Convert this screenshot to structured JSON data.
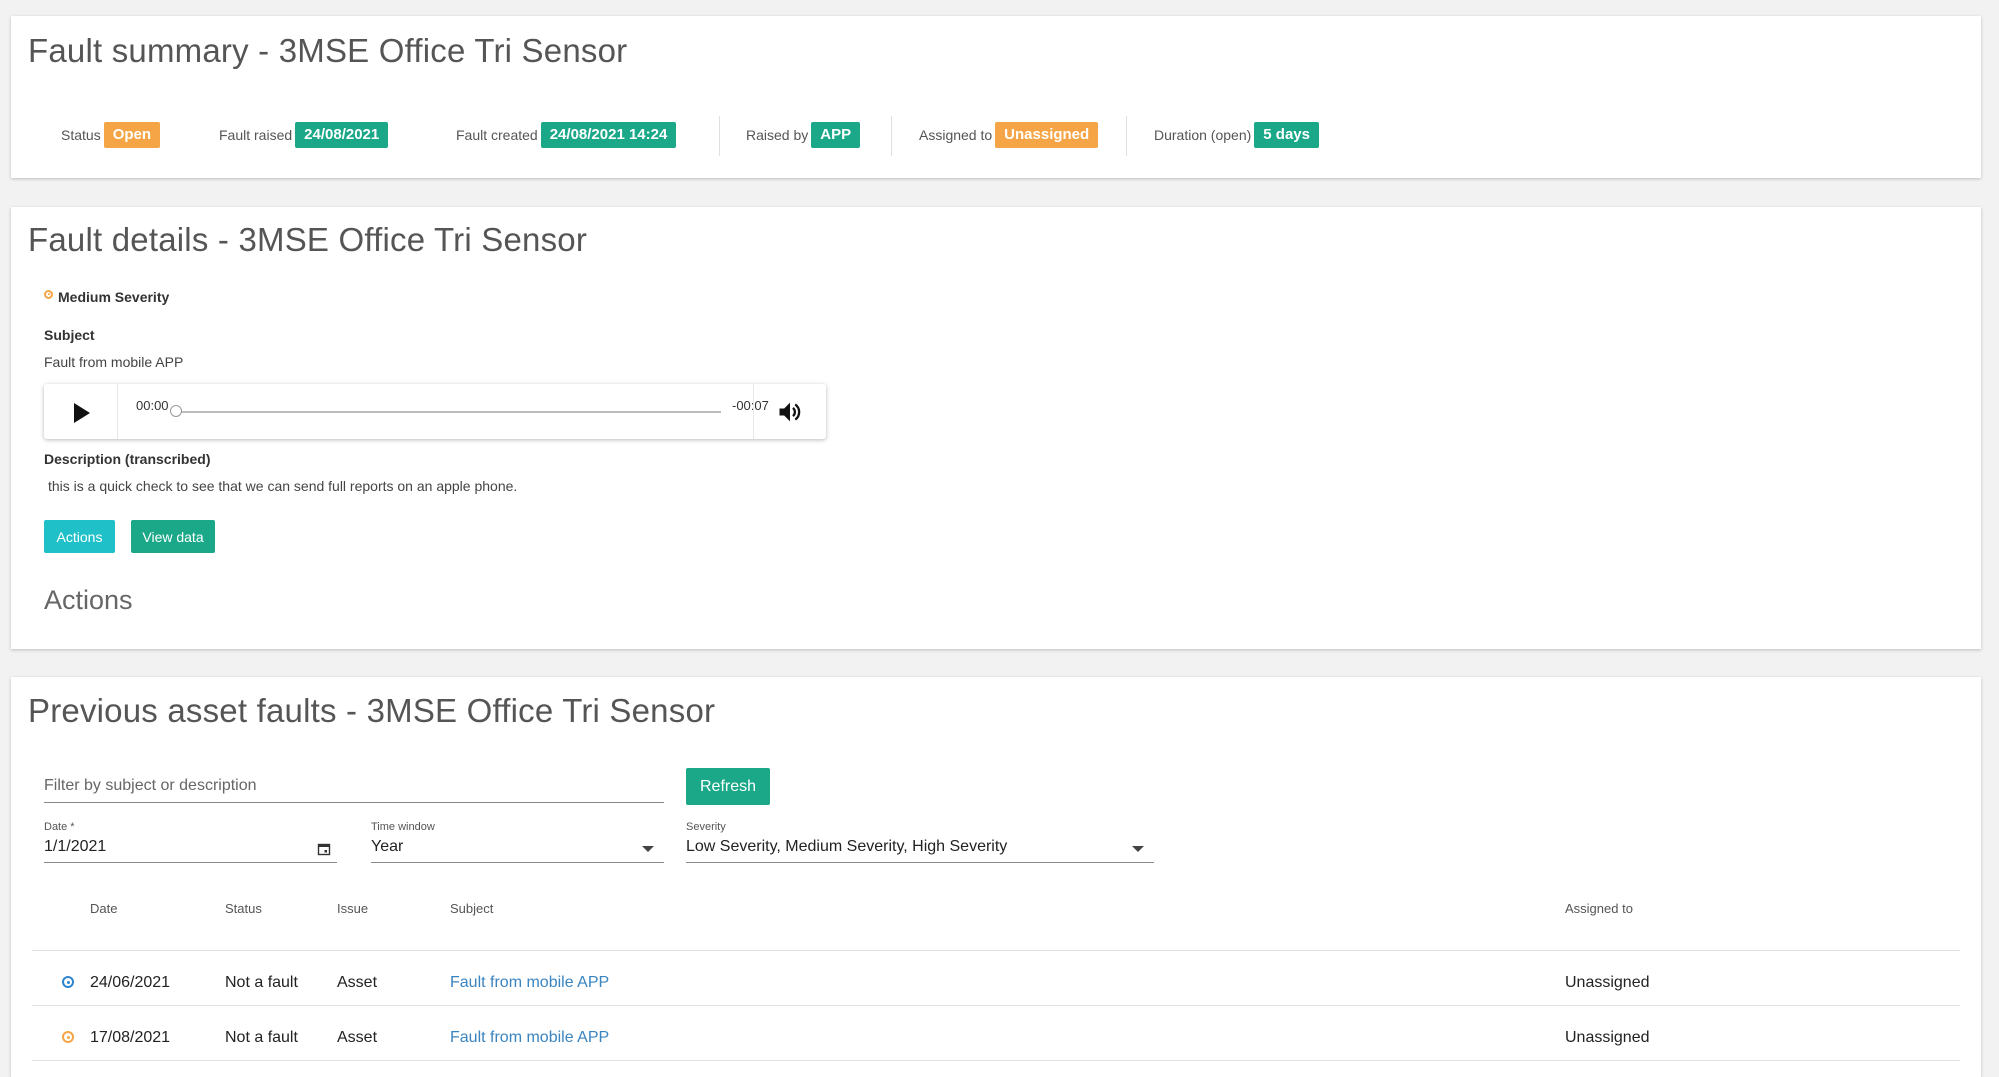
{
  "summary": {
    "title": "Fault summary - 3MSE Office Tri Sensor",
    "status": {
      "label": "Status",
      "value": "Open"
    },
    "fault_raised": {
      "label": "Fault raised",
      "value": "24/08/2021"
    },
    "fault_created": {
      "label": "Fault created",
      "value": "24/08/2021 14:24"
    },
    "raised_by": {
      "label": "Raised by",
      "value": "APP"
    },
    "assigned_to": {
      "label": "Assigned to",
      "value": "Unassigned"
    },
    "duration": {
      "label": "Duration (open)",
      "value": "5 days"
    }
  },
  "details": {
    "title": "Fault details - 3MSE Office Tri Sensor",
    "severity": "Medium Severity",
    "subject_label": "Subject",
    "subject_value": "Fault from mobile APP",
    "audio": {
      "current_time": "00:00",
      "remaining_time": "-00:07"
    },
    "description_label": "Description (transcribed)",
    "description_value": "this is a quick check to see that we can send full reports on an apple phone.",
    "actions_button": "Actions",
    "view_data_button": "View data",
    "actions_heading": "Actions"
  },
  "previous": {
    "title": "Previous asset faults - 3MSE Office Tri Sensor",
    "filter_placeholder": "Filter by subject or description",
    "refresh_button": "Refresh",
    "date_label": "Date *",
    "date_value": "1/1/2021",
    "time_window_label": "Time window",
    "time_window_value": "Year",
    "severity_label": "Severity",
    "severity_value": "Low Severity, Medium Severity, High Severity",
    "columns": {
      "date": "Date",
      "status": "Status",
      "issue": "Issue",
      "subject": "Subject",
      "assigned_to": "Assigned to"
    },
    "rows": [
      {
        "date": "24/06/2021",
        "status": "Not a fault",
        "issue": "Asset",
        "subject": "Fault from mobile APP",
        "assigned_to": "Unassigned",
        "severity_color": "#2e86d0"
      },
      {
        "date": "17/08/2021",
        "status": "Not a fault",
        "issue": "Asset",
        "subject": "Fault from mobile APP",
        "assigned_to": "Unassigned",
        "severity_color": "#f5a545"
      }
    ]
  },
  "colors": {
    "orange": "#f5a545",
    "green": "#1aa888",
    "teal": "#20c0c8",
    "link": "#3a84c0"
  }
}
